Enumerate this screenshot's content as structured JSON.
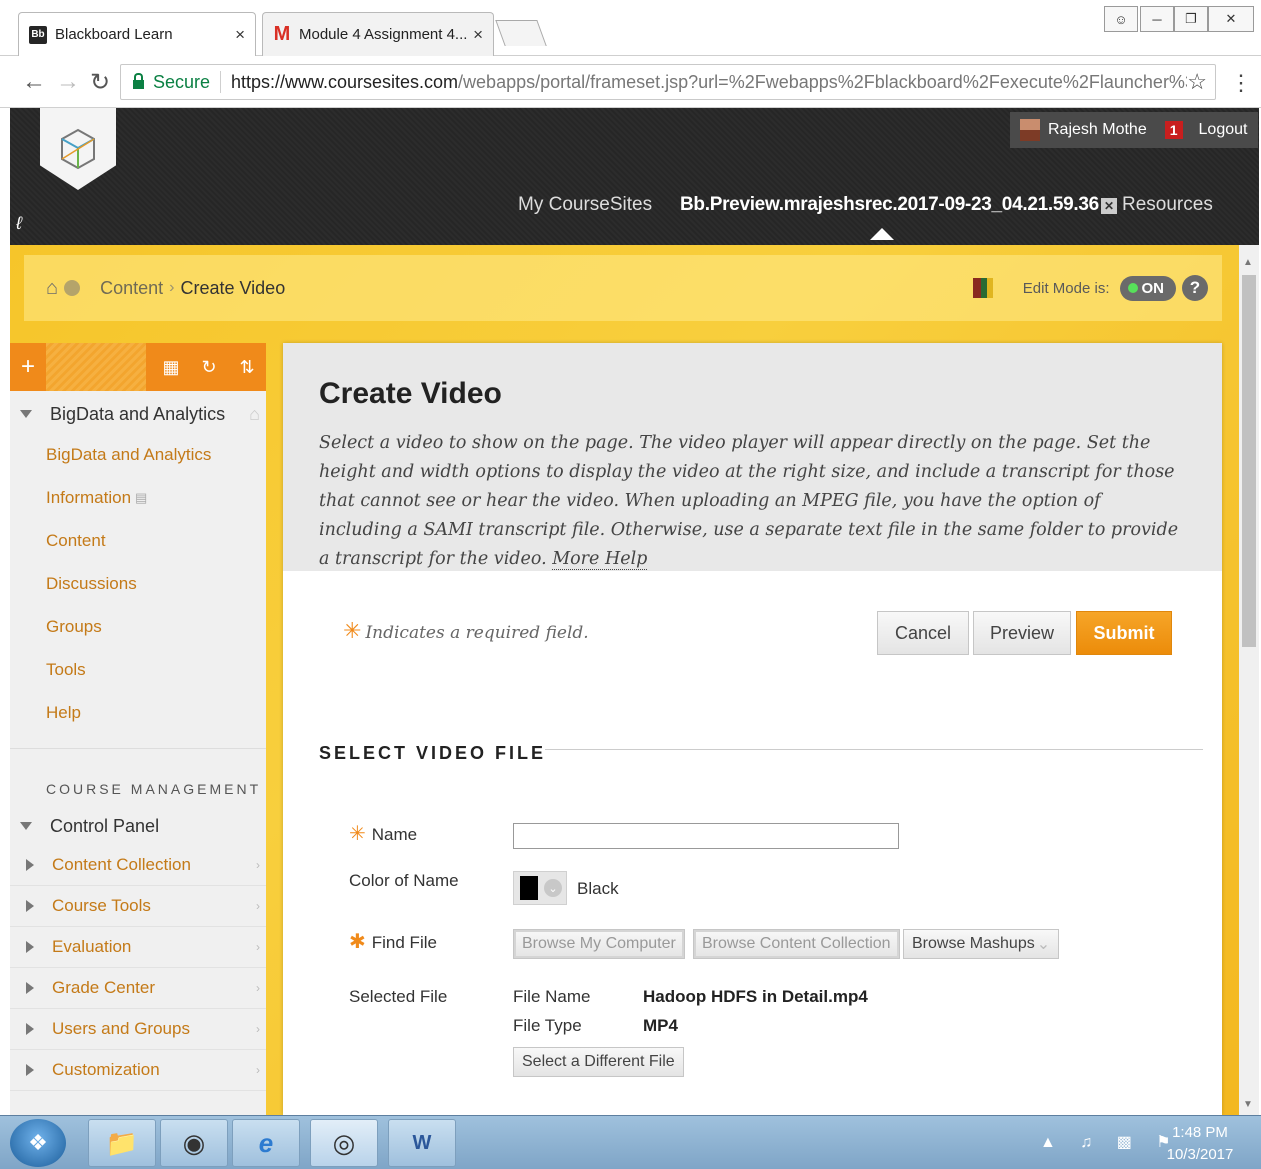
{
  "browser": {
    "tabs": [
      {
        "label": "Blackboard Learn",
        "favicon": "Bb",
        "close": "×"
      },
      {
        "label": "Module 4 Assignment 4...",
        "favicon": "M",
        "close": "×"
      }
    ],
    "url": {
      "secure_label": "Secure",
      "host": "https://www.coursesites.com",
      "rest": "/webapps/portal/frameset.jsp?url=%2Fwebapps%2Fblackboard%2Fexecute%2Flauncher%3Ftyp..."
    }
  },
  "header": {
    "user_name": "Rajesh Mothe",
    "notifications": "1",
    "logout_label": "Logout",
    "nav": {
      "my_coursesites": "My CourseSites",
      "course": "Bb.Preview.mrajeshsrec.2017-09-23_04.21.59.36",
      "resources": "Resources"
    }
  },
  "breadcrumb": {
    "items": [
      "Content",
      "Create Video"
    ],
    "edit_mode_label": "Edit Mode is:",
    "edit_mode_value": "ON"
  },
  "course_menu": {
    "course_title": "BigData and Analytics",
    "items": [
      "BigData and Analytics",
      "Information",
      "Content",
      "Discussions",
      "Groups",
      "Tools",
      "Help"
    ],
    "management_heading": "COURSE MANAGEMENT",
    "control_panel": "Control Panel",
    "control_items": [
      "Content Collection",
      "Course Tools",
      "Evaluation",
      "Grade Center",
      "Users and Groups",
      "Customization"
    ]
  },
  "page": {
    "title": "Create Video",
    "instructions": "Select a video to show on the page. The video player will appear directly on the page. Set the height and width options to display the video at the right size, and include a transcript for those that cannot see or hear the video. When uploading an MPEG file, you have the option of including a SAMI transcript file. Otherwise, use a separate text file in the same folder to provide a transcript for the video.",
    "more_help": "More Help",
    "required_note": "Indicates a required field.",
    "buttons": {
      "cancel": "Cancel",
      "preview": "Preview",
      "submit": "Submit"
    },
    "section_title": "SELECT VIDEO FILE",
    "fields": {
      "name_label": "Name",
      "name_value": "",
      "color_label": "Color of Name",
      "color_value": "Black",
      "find_file_label": "Find File",
      "browse_computer": "Browse My Computer",
      "browse_collection": "Browse Content Collection",
      "browse_mashups": "Browse Mashups",
      "selected_file_label": "Selected File",
      "file_name_key": "File Name",
      "file_name_value": "Hadoop HDFS in Detail.mp4",
      "file_type_key": "File Type",
      "file_type_value": "MP4",
      "select_different": "Select a Different File"
    }
  },
  "taskbar": {
    "time": "1:48 PM",
    "date": "10/3/2017"
  },
  "colors": {
    "accent_orange": "#f08a1a",
    "header_dark": "#262626",
    "content_yellow": "#f6c52a",
    "link_orange": "#c47a18"
  }
}
